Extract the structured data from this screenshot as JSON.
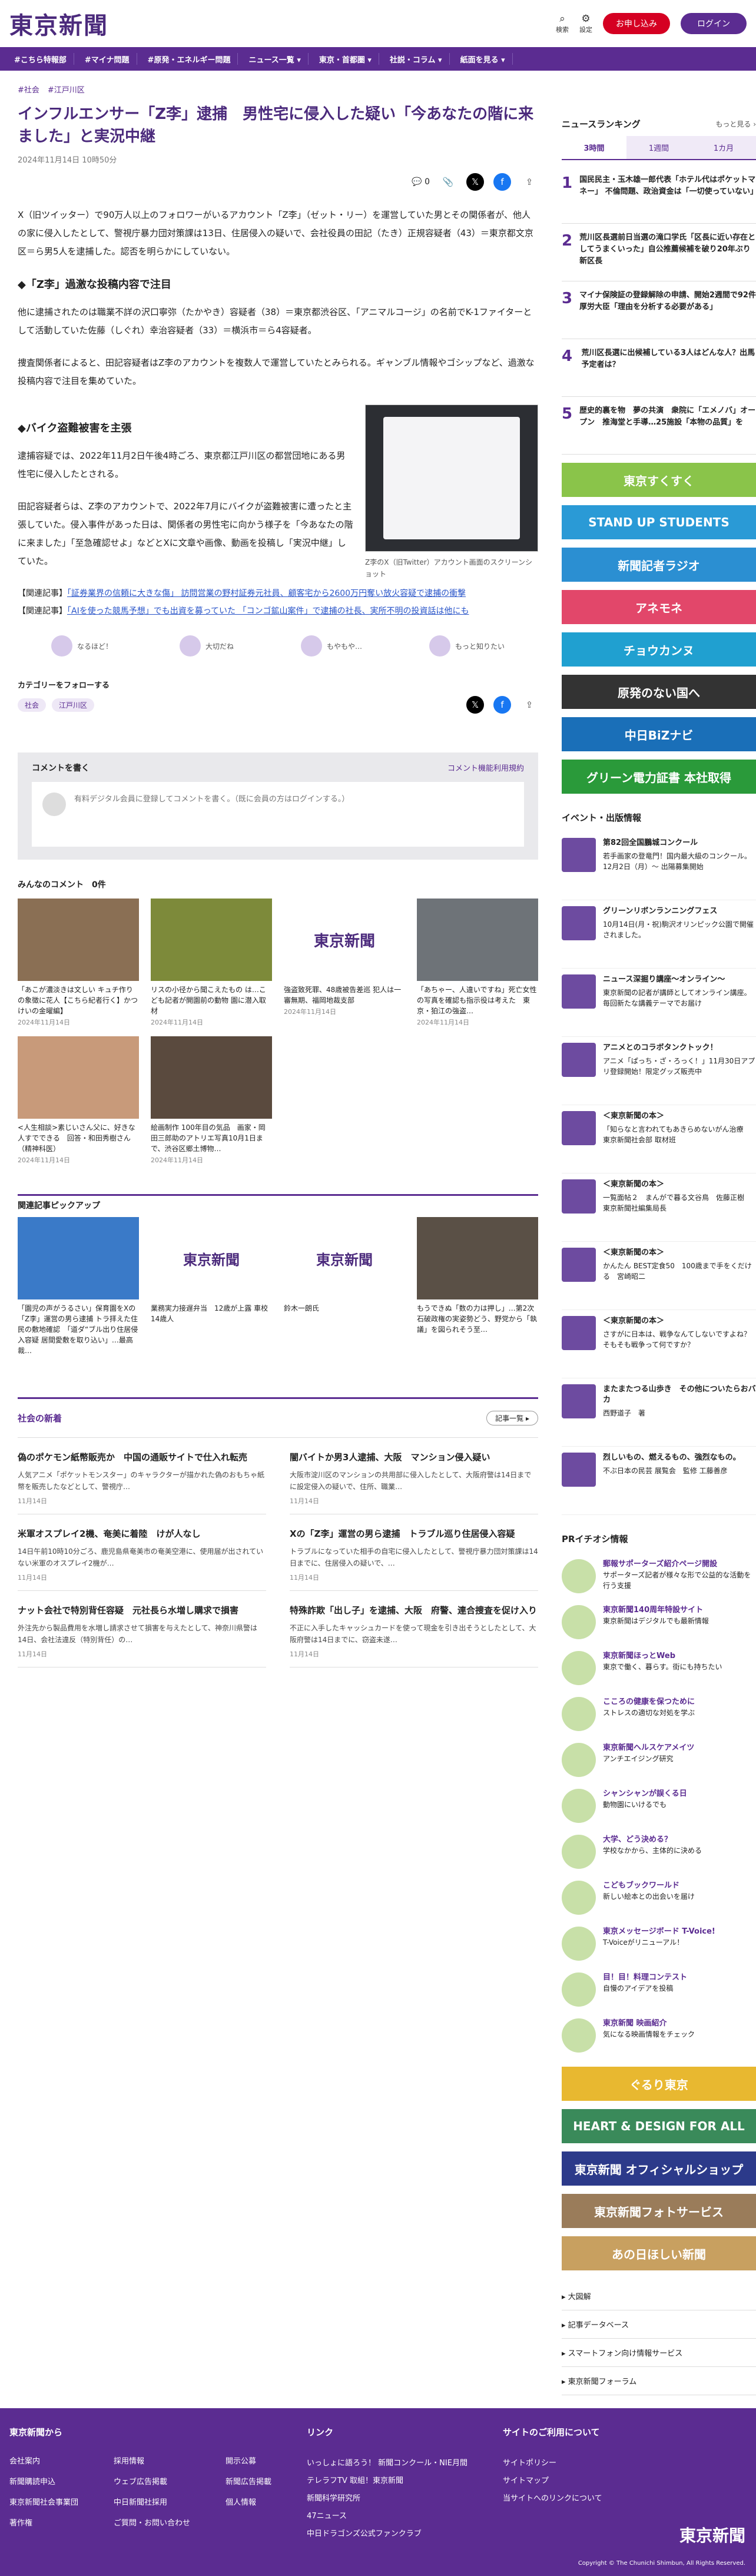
{
  "header": {
    "logo": "東京新聞",
    "search": "検索",
    "settings": "設定",
    "subscribe": "お申し込み",
    "login": "ログイン"
  },
  "nav": [
    "#こちら特報部",
    "#マイナ問題",
    "#原発・エネルギー問題",
    "ニュース一覧 ▾",
    "東京・首都圏 ▾",
    "社説・コラム ▾",
    "紙面を見る ▾"
  ],
  "article": {
    "tags": [
      "#社会",
      "#江戸川区"
    ],
    "title": "インフルエンサー「Z李」逮捕　男性宅に侵入した疑い「今あなたの階に来ました」と実況中継",
    "date": "2024年11月14日 10時50分",
    "comment_count": "0",
    "p1": "X（旧ツイッター）で90万人以上のフォロワーがいるアカウント「Z李」（ゼット・リー）を運営していた男とその関係者が、他人の家に侵入したとして、警視庁暴力団対策課は13日、住居侵入の疑いで、会社役員の田記（たき）正規容疑者（43）＝東京都文京区＝ら男5人を逮捕した。認否を明らかにしていない。",
    "h2a": "◆「Z李」過激な投稿内容で注目",
    "p2": "他に逮捕されたのは職業不詳の沢口寧弥（たかやき）容疑者（38）＝東京都渋谷区、「アニマルコージ」の名前でK-1ファイターとして活動していた佐藤（しぐれ）幸治容疑者（33）＝横浜市＝ら4容疑者。",
    "p3": "捜査関係者によると、田記容疑者はZ李のアカウントを複数人で運営していたとみられる。ギャンブル情報やゴシップなど、過激な投稿内容で注目を集めていた。",
    "h2b": "◆バイク盗難被害を主張",
    "p4": "逮捕容疑では、2022年11月2日午後4時ごろ、東京都江戸川区の都営団地にある男性宅に侵入したとされる。",
    "p5": "田記容疑者らは、Z李のアカウントで、2022年7月にバイクが盗難被害に遭ったと主張していた。侵入事件があった日は、関係者の男性宅に向かう様子を「今あなたの階に来ました」「至急確認せよ」などとXに文章や画像、動画を投稿し「実況中継」していた。",
    "figcap": "Z李のX（旧Twitter）アカウント画面のスクリーンショット",
    "rel1_label": "【関連記事】",
    "rel1": "「証券業界の信頼に大きな傷」 訪問営業の野村証券元社員、顧客宅から2600万円奪い放火容疑で逮捕の衝撃",
    "rel2_label": "【関連記事】",
    "rel2": "「AIを使った競馬予想」でも出資を募っていた 「コンゴ鉱山案件」で逮捕の社長、実所不明の投資話は他にも",
    "reactions": [
      "なるほど！",
      "大切だね",
      "もやもや…",
      "もっと知りたい"
    ],
    "follow": "カテゴリーをフォローする",
    "follow_tags": [
      "社会",
      "江戸川区"
    ]
  },
  "comments": {
    "title": "コメントを書く",
    "policy": "コメント機能利用規約",
    "prompt": "有料デジタル会員に登録してコメントを書く。（既に会員の方はログインする。）"
  },
  "everyone": {
    "title": "みんなのコメント　0件",
    "cards": [
      {
        "t": "「あこが濃淡きは文しい キュチ作りの象徴に花人【こちら紀者行く】かつけいの金曜編】",
        "d": "2024年11月14日"
      },
      {
        "t": "リスの小径から聞こえたもの は…こども記者が開園前の動物 園に潜入取材",
        "d": "2024年11月14日"
      },
      {
        "t": "強盗致死罪、48歳被告差巡 犯人は一審無期、福岡地裁支部",
        "d": "2024年11月14日"
      },
      {
        "t": "「あちゃー、人違いですね」死亡女性の写真を確認も指示役は考えた　東京・狛江の強盗…",
        "d": "2024年11月14日"
      },
      {
        "t": "<人生相談>素じいさん父に、好きな人すでできる　回答・和田秀樹さん（精神科医）",
        "d": "2024年11月14日"
      },
      {
        "t": "絵画制作 100年目の気品　画家・岡田三郎助のアトリエ写真10月1日まで、渋谷区郷土博物…",
        "d": "2024年11月14日"
      }
    ]
  },
  "pickup": {
    "title": "関連記事ピックアップ",
    "items": [
      "「園児の声がうるさい」保育園をXの「Z李」運営の男ら逮捕 トラ拝えた住民の敷地確認　「道ダ“ブル出り住居侵入容疑 居間愛敷を取り込い」…最高裁…",
      "業務実力接遅弁当　12歳が上露 車校14歳人",
      "鈴木一朗氏",
      "もうできぬ「数の力は押し」…第2次石破政権の実姿勢どう、野党から「執議」を図られそう至…"
    ]
  },
  "social": {
    "title": "社会の新着",
    "more": "記事一覧 ▸",
    "items": [
      {
        "t": "偽のポケモン紙幣販売か　中国の通販サイトで仕入れ転売",
        "s": "人気アニメ「ポケットモンスター」のキャラクターが描かれた偽のおもちゃ紙幣を販売したなどとして、警視庁…",
        "d": "11月14日"
      },
      {
        "t": "闇バイトか男3人逮捕、大阪　マンション侵入疑い",
        "s": "大阪市淀川区のマンションの共用部に侵入したとして、大阪府警は14日までに設定侵入の疑いで、住所、職業…",
        "d": "11月14日"
      },
      {
        "t": "米軍オスプレイ2機、奄美に着陸　けが人なし",
        "s": "14日午前10時10分ごろ、鹿児島県奄美市の奄美空港に、使用届が出されていない米軍のオスプレイ2機が…",
        "d": "11月14日"
      },
      {
        "t": "Xの「Z李」運営の男ら逮捕　トラブル巡り住居侵入容疑",
        "s": "トラブルになっていた相手の自宅に侵入したとして、警視庁暴力団対策課は14日までに、住居侵入の疑いで、…",
        "d": "11月14日"
      },
      {
        "t": "ナット会社で特別背任容疑　元社長ら水増し購求で損害",
        "s": "外注先から製品費用を水増し請求させて損害を与えたとして、神奈川県警は14日、会社法違反（特別背任）の…",
        "d": "11月14日"
      },
      {
        "t": "特殊詐欺「出し子」を逮捕、大阪　府警、連合捜査を促け入り",
        "s": "不正に入手したキャッシュカードを使って現金を引き出そうとしたとして、大阪府警は14日までに、窃盗未遂…",
        "d": "11月14日"
      }
    ]
  },
  "sidebar": {
    "ranking_title": "ニュースランキング",
    "ranking_more": "もっと見る ›",
    "tabs": [
      "3時間",
      "1週間",
      "1カ月"
    ],
    "ranks": [
      "国民民主・玉木雄一郎代表「ホテル代はポケットマネー」 不倫問題、政治資金は「一切使っていない」",
      "荒川区長選前日当選の滝口学氏「区長に近い存在としてうまくいった」自公推薦候補を破り20年ぶり新区長",
      "マイナ保険証の登録解除の申請、開始2週間で92件　厚労大臣「理由を分析する必要がある」",
      "荒川区長選に出候補している3人はどんな人？出馬予定者は？",
      "歴史的裏を物　夢の共演　衆院に「エメノバ」オープン　推海堂と手導…25施設「本物の品質」を"
    ],
    "banners": [
      {
        "t": "東京すくすく",
        "c": "#8ac44a"
      },
      {
        "t": "STAND UP STUDENTS",
        "c": "#2a9ad6"
      },
      {
        "t": "新聞記者ラジオ",
        "c": "#2b8fd2"
      },
      {
        "t": "アネモネ",
        "c": "#e2476a"
      },
      {
        "t": "チョウカンヌ",
        "c": "#20a0d0"
      },
      {
        "t": "原発のない国へ",
        "c": "#333333"
      },
      {
        "t": "中日BiZナビ",
        "c": "#1a6fb8"
      },
      {
        "t": "グリーン電力証書 本社取得",
        "c": "#2a9a3a"
      }
    ],
    "events_title": "イベント・出版情報",
    "events": [
      {
        "b": "第82回全国鵬城コンクール",
        "t": "若手画家の登竜門！国内最大級のコンクール。12月2日（月）～ 出陽募集開始"
      },
      {
        "b": "グリーンリボンランニングフェス",
        "t": "10月14日(月・祝)駒沢オリンピック公園で開催されました。"
      },
      {
        "b": "ニュース深掘り講座～オンライン～",
        "t": "東京新聞の記者が講師としてオンライン講座。毎回新たな講義テーマでお届け"
      },
      {
        "b": "アニメとのコラボタンクトック！",
        "t": "アニメ「ぱっち・ざ・ろっく！」11月30日アプリ登録開始！限定グッズ販売中"
      },
      {
        "b": "＜東京新聞の本＞",
        "t": "「知らなと言われてもあきらめないがん治療　東京新聞社会部 取材班"
      },
      {
        "b": "＜東京新聞の本＞",
        "t": "一覧面帖２　まんがで暮る文谷鳥　佐藤正樹　東京新聞社編集局長"
      },
      {
        "b": "＜東京新聞の本＞",
        "t": "かんたん BEST定食50　100歳まで手をくだける　宮崎昭二"
      },
      {
        "b": "＜東京新聞の本＞",
        "t": "さすがに日本は、戦争なんてしないですよね？　そもそも戦争って何ですか？"
      },
      {
        "b": "またまたつる山歩き　その他についたらおバカ",
        "t": "西野道子　著"
      },
      {
        "b": "烈しいもの、燃えるもの、強烈なもの。",
        "t": "不ぶ日本の民芸 展覧会　監修 工藤善彦"
      }
    ],
    "pr_title": "PRイチオシ情報",
    "pr": [
      {
        "b": "郵報サポーターズ紹介ページ開設",
        "t": "サポーターズ記者が様々な形で公益的な活動を行う支援"
      },
      {
        "b": "東京新聞140周年特設サイト",
        "t": "東京新聞はデジタルでも最新情報"
      },
      {
        "b": "東京新聞ほっとWeb",
        "t": "東京で働く、暮らす。街にも持ちたい"
      },
      {
        "b": "こころの健康を保つために",
        "t": "ストレスの適切な対処を学ぶ"
      },
      {
        "b": "東京新聞ヘルスケアメイツ",
        "t": "アンチエイジング研究"
      },
      {
        "b": "シャンシャンが誤くる日",
        "t": "動物園にいけるでも"
      },
      {
        "b": "大学、どう決める？",
        "t": "学校なかから、主体的に決める"
      },
      {
        "b": "こどもブックワールド",
        "t": "新しい絵本との出会いを届け"
      },
      {
        "b": "東京メッセージボード T-Voice!",
        "t": "T-Voiceがリニューアル！"
      },
      {
        "b": "目！目！料理コンテスト",
        "t": "自慢のアイデアを投稿"
      },
      {
        "b": "東京新聞 映画紹介",
        "t": "気になる映画情報をチェック"
      }
    ],
    "banners2": [
      {
        "t": "ぐるり東京",
        "c": "#e8b830"
      },
      {
        "t": "HEART & DESIGN FOR ALL",
        "c": "#3a8a5a"
      },
      {
        "t": "東京新聞 オフィシャルショップ",
        "c": "#2c3a8a"
      },
      {
        "t": "東京新聞フォトサービス",
        "c": "#9a7c5a"
      },
      {
        "t": "あの日ほしい新聞",
        "c": "#c8a060"
      }
    ],
    "links": [
      "大図解",
      "記事データベース",
      "スマートフォン向け情報サービス",
      "東京新聞フォーラム"
    ]
  },
  "footer": {
    "col1_title": "東京新聞から",
    "col1": [
      "会社案内",
      "採用情報",
      "開示公募",
      "新聞購読申込",
      "ウェブ広告掲載",
      "新聞広告掲載",
      "東京新聞社会事業団",
      "中日新聞社採用",
      "個人情報",
      "著作権",
      "ご質問・お問い合わせ"
    ],
    "col2_title": "リンク",
    "col2": [
      "いっしょに語ろう！ 新聞コンクール・NIE月間",
      "テレラフTV 取組！東京新聞",
      "新聞科学研究所",
      "47ニュース",
      "中日ドラゴンズ公式ファンクラブ"
    ],
    "col3_title": "サイトのご利用について",
    "col3": [
      "サイトポリシー",
      "サイトマップ",
      "当サイトへのリンクについて"
    ],
    "logo": "東京新聞",
    "copyright": "Copyright © The Chunichi Shimbun, All Rights Reserved."
  }
}
